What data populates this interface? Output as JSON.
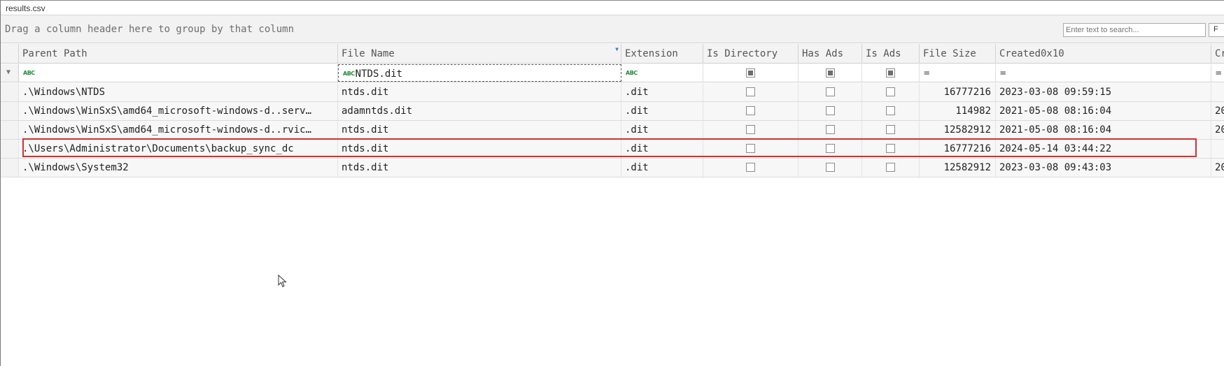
{
  "window": {
    "title": "results.csv"
  },
  "toolbar": {
    "group_hint": "Drag a column header here to group by that column",
    "search_placeholder": "Enter text to search...",
    "find_label": "F"
  },
  "columns": [
    {
      "key": "parent_path",
      "label": "Parent Path"
    },
    {
      "key": "file_name",
      "label": "File Name"
    },
    {
      "key": "extension",
      "label": "Extension"
    },
    {
      "key": "is_directory",
      "label": "Is Directory"
    },
    {
      "key": "has_ads",
      "label": "Has Ads"
    },
    {
      "key": "is_ads",
      "label": "Is Ads"
    },
    {
      "key": "file_size",
      "label": "File Size"
    },
    {
      "key": "created",
      "label": "Created0x10"
    },
    {
      "key": "created2",
      "label": "Cr"
    }
  ],
  "filters": {
    "parent_path": "",
    "file_name": "NTDS.dit",
    "extension": "",
    "file_size_op": "=",
    "created_op": "=",
    "created2_op": "="
  },
  "rows": [
    {
      "parent_path": ".\\Windows\\NTDS",
      "file_name": "ntds.dit",
      "extension": ".dit",
      "file_size": "16777216",
      "created": "2023-03-08 09:59:15",
      "created2": ""
    },
    {
      "parent_path": ".\\Windows\\WinSxS\\amd64_microsoft-windows-d..serv…",
      "file_name": "adamntds.dit",
      "extension": ".dit",
      "file_size": "114982",
      "created": "2021-05-08 08:16:04",
      "created2": "20"
    },
    {
      "parent_path": ".\\Windows\\WinSxS\\amd64_microsoft-windows-d..rvic…",
      "file_name": "ntds.dit",
      "extension": ".dit",
      "file_size": "12582912",
      "created": "2021-05-08 08:16:04",
      "created2": "20"
    },
    {
      "parent_path": ".\\Users\\Administrator\\Documents\\backup_sync_dc",
      "file_name": "ntds.dit",
      "extension": ".dit",
      "file_size": "16777216",
      "created": "2024-05-14 03:44:22",
      "created2": ""
    },
    {
      "parent_path": ".\\Windows\\System32",
      "file_name": "ntds.dit",
      "extension": ".dit",
      "file_size": "12582912",
      "created": "2023-03-08 09:43:03",
      "created2": "20"
    }
  ],
  "colors": {
    "highlight": "#d32f2f",
    "filter_icon": "#3a7bd5",
    "abc_icon": "#1f8a3a"
  }
}
